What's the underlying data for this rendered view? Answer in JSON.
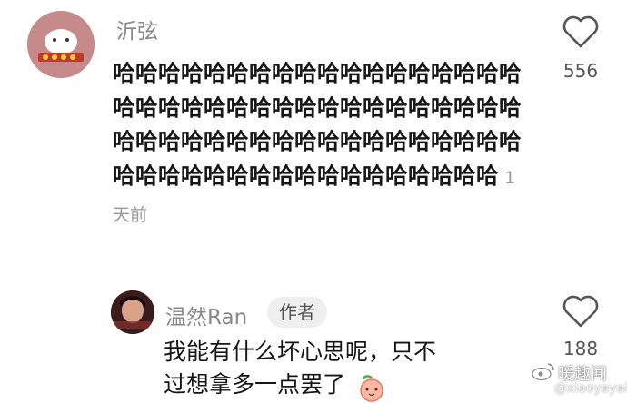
{
  "comment": {
    "username": "沂弦",
    "text": "哈哈哈哈哈哈哈哈哈哈哈哈哈哈哈哈哈哈哈哈哈哈哈哈哈哈哈哈哈哈哈哈哈哈哈哈哈哈哈哈哈哈哈哈哈哈哈哈哈哈哈哈哈哈哈哈哈哈哈哈哈哈哈哈哈哈哈哈哈哈哈",
    "time": "1天前",
    "likes": "556"
  },
  "reply": {
    "username": "温然Ran",
    "badge": "作者",
    "text": "我能有什么坏心思呢，只不过想拿多一点罢了",
    "likes": "188"
  },
  "watermark": {
    "name": "暖趣闻",
    "handle": "@xiaoyayai"
  },
  "colors": {
    "username": "#888888",
    "text": "#161616",
    "meta": "#999999",
    "badge_bg": "#efefef"
  },
  "icons": {
    "like": "heart-outline-icon",
    "watermark": "weibo-icon"
  }
}
